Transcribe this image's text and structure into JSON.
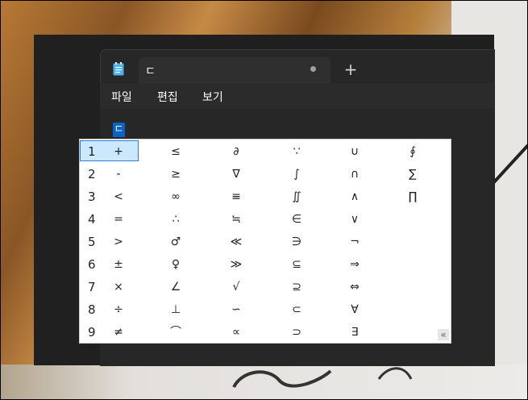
{
  "tab": {
    "title": "ㄷ"
  },
  "new_tab_label": "+",
  "menu": [
    {
      "label": "파일"
    },
    {
      "label": "편집"
    },
    {
      "label": "보기"
    }
  ],
  "editor": {
    "composing_char": "ㄷ"
  },
  "ime": {
    "selected_index": 0,
    "collapse_label": "«",
    "rows": [
      {
        "num": "1",
        "cands": [
          "+",
          "≤",
          "∂",
          "∵",
          "∪",
          "∮"
        ]
      },
      {
        "num": "2",
        "cands": [
          "-",
          "≥",
          "∇",
          "∫",
          "∩",
          "∑"
        ]
      },
      {
        "num": "3",
        "cands": [
          "<",
          "∞",
          "≡",
          "∬",
          "∧",
          "∏"
        ]
      },
      {
        "num": "4",
        "cands": [
          "=",
          "∴",
          "≒",
          "∈",
          "∨",
          ""
        ]
      },
      {
        "num": "5",
        "cands": [
          ">",
          "♂",
          "≪",
          "∋",
          "¬",
          ""
        ]
      },
      {
        "num": "6",
        "cands": [
          "±",
          "♀",
          "≫",
          "⊆",
          "⇒",
          ""
        ]
      },
      {
        "num": "7",
        "cands": [
          "×",
          "∠",
          "√",
          "⊇",
          "⇔",
          ""
        ]
      },
      {
        "num": "8",
        "cands": [
          "÷",
          "⊥",
          "∽",
          "⊂",
          "∀",
          ""
        ]
      },
      {
        "num": "9",
        "cands": [
          "≠",
          "⌒",
          "∝",
          "⊃",
          "∃",
          ""
        ]
      }
    ]
  }
}
